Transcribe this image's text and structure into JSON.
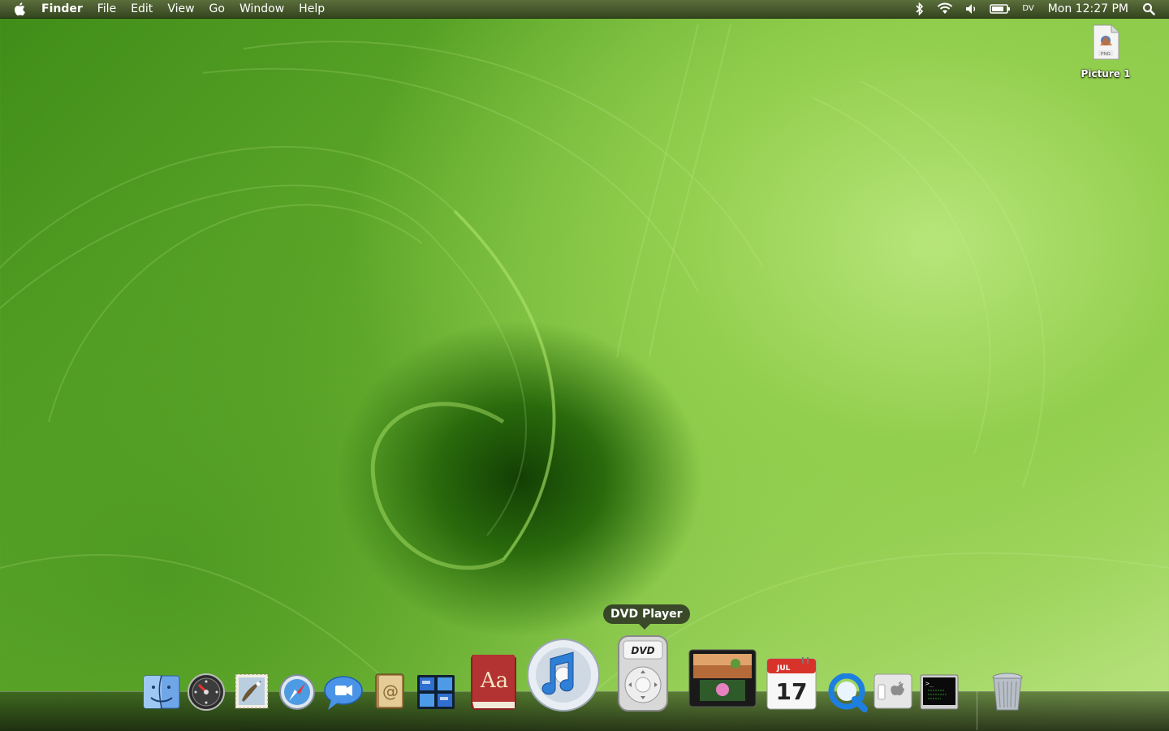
{
  "menubar": {
    "app_name": "Finder",
    "menus": [
      "File",
      "Edit",
      "View",
      "Go",
      "Window",
      "Help"
    ],
    "extras": [
      "bluetooth-icon",
      "wifi-icon",
      "volume-icon",
      "battery-icon"
    ],
    "display_label": "DV",
    "clock": "Mon 12:27 PM"
  },
  "desktop": {
    "icons": [
      {
        "label": "Picture 1",
        "badge": "PNG"
      }
    ]
  },
  "dock": {
    "tooltip": "DVD Player",
    "calendar": {
      "month": "JUL",
      "day": "17"
    },
    "dictionary_text": "Aa",
    "dvd_label": "DVD",
    "apps": [
      "finder",
      "dashboard",
      "mail",
      "safari",
      "ichat",
      "address-book",
      "spaces",
      "dictionary",
      "itunes",
      "dvd-player",
      "photo-booth",
      "ical",
      "quicktime",
      "system-preferences",
      "terminal",
      "trash"
    ]
  },
  "colors": {
    "menubar": "#3f5226",
    "wallpaper_light": "#b9e37e",
    "wallpaper_dark": "#123f04"
  }
}
